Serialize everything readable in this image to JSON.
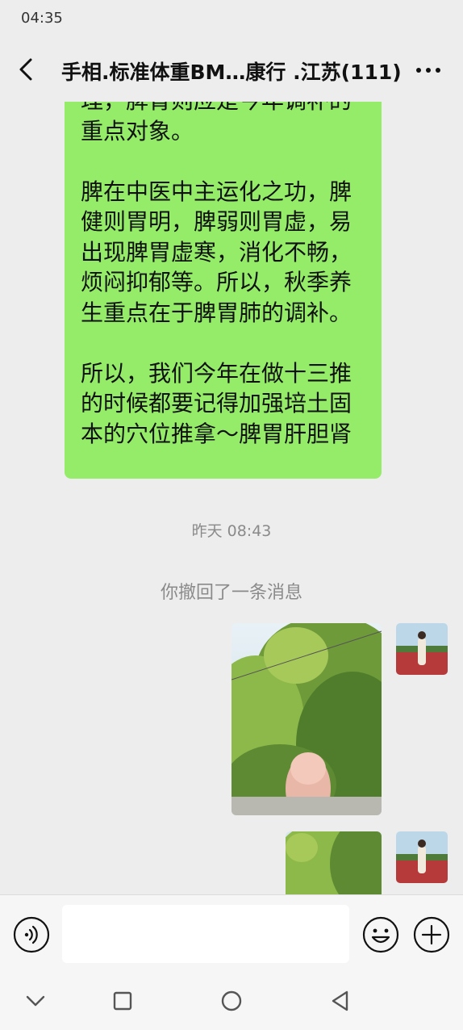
{
  "status_bar": {
    "time": "04:35"
  },
  "header": {
    "title": "手相.标准体重BM…康行 .江苏(111)"
  },
  "messages": {
    "text_bubble": "理，脾胃则应是今年调补的\n重点对象。\n\n脾在中医中主运化之功，脾\n健则胃明，脾弱则胃虚，易\n出现脾胃虚寒，消化不畅，\n烦闷抑郁等。所以，秋季养\n生重点在于脾胃肺的调补。\n\n所以，我们今年在做十三推\n的时候都要记得加强培土固\n本的穴位推拿～脾胃肝胆肾",
    "timestamp": "昨天 08:43",
    "recalled_notice": "你撤回了一条消息"
  },
  "input": {
    "placeholder": ""
  },
  "colors": {
    "bubble_green": "#95ec69",
    "background": "#ededed"
  },
  "icons": [
    "back-arrow-icon",
    "more-dots-icon",
    "voice-icon",
    "emoji-icon",
    "plus-icon",
    "nav-back-icon",
    "nav-home-icon",
    "nav-recents-icon",
    "nav-down-icon"
  ]
}
